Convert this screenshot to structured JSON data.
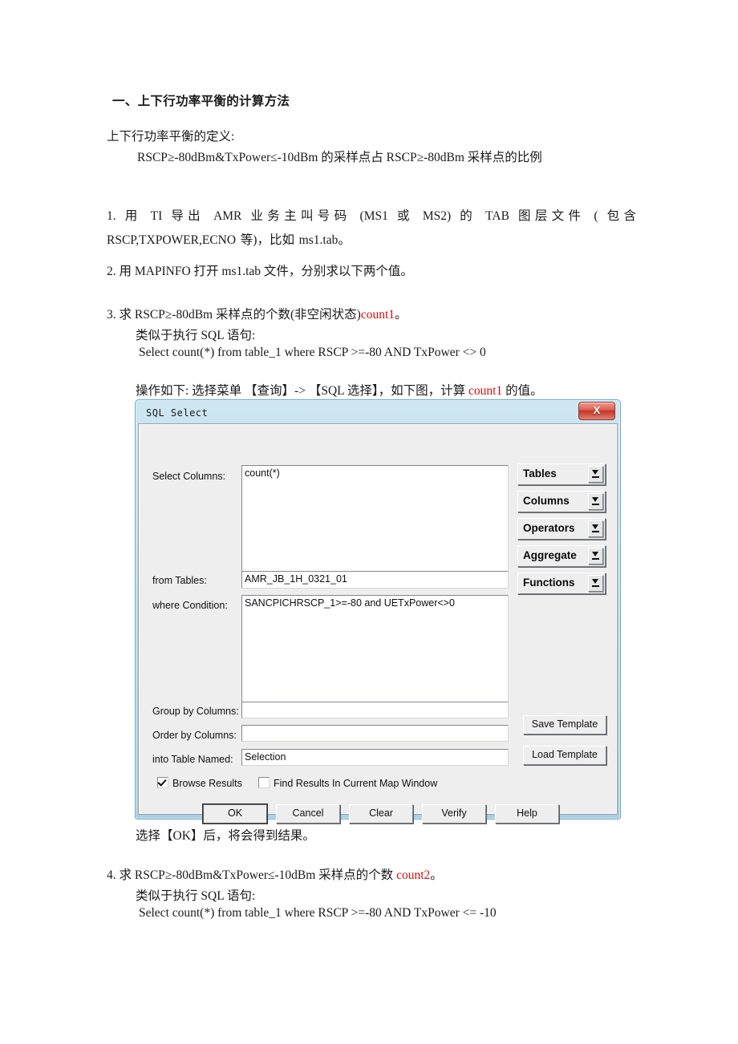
{
  "document": {
    "heading": "一、上下行功率平衡的计算方法",
    "definition_label": "上下行功率平衡的定义:",
    "definition_text": "RSCP≥-80dBm&TxPower≤-10dBm 的采样点占 RSCP≥-80dBm 采样点的比例",
    "step1": "1. 用 TI 导出 AMR 业务主叫号码 (MS1 或 MS2) 的 TAB 图层文件 ( 包含 RSCP,TXPOWER,ECNO 等)，比如 ms1.tab。",
    "step2": "2. 用 MAPINFO 打开 ms1.tab 文件，分别求以下两个值。",
    "step3_line1_a": "3. 求 RSCP≥-80dBm 采样点的个数(非空闲状态)",
    "step3_line1_red": "count1",
    "step3_line1_b": "。",
    "step3_line2": "类似于执行 SQL 语句:",
    "step3_sql": "Select count(*) from table_1 where RSCP >=-80 AND TxPower <> 0",
    "operation_a": "操作如下: 选择菜单 【查询】-> 【SQL 选择】，如下图，计算 ",
    "operation_red": "count1",
    "operation_b": " 的值。",
    "after_dialog": "选择【OK】后，将会得到结果。",
    "step4_a": "4. 求 RSCP≥-80dBm&TxPower≤-10dBm 采样点的个数 ",
    "step4_red": "count2",
    "step4_b": "。",
    "step4_line2": "类似于执行 SQL 语句:",
    "step4_sql": "Select count(*) from table_1 where RSCP >=-80 AND TxPower <= -10",
    "highlight_color": "#d01010"
  },
  "dialog": {
    "title": "SQL Select",
    "close_glyph": "X",
    "fields": {
      "select_columns_label": "Select Columns:",
      "select_columns_value": "count(*)",
      "from_tables_label": "from Tables:",
      "from_tables_value": "AMR_JB_1H_0321_01",
      "where_condition_label": "where Condition:",
      "where_condition_value": "SANCPICHRSCP_1>=-80 and UETxPower<>0",
      "group_by_label": "Group by Columns:",
      "group_by_value": "",
      "order_by_label": "Order by Columns:",
      "order_by_value": "",
      "into_table_label": "into Table Named:",
      "into_table_value": "Selection"
    },
    "dropdowns": [
      {
        "label": "Tables"
      },
      {
        "label": "Columns"
      },
      {
        "label": "Operators"
      },
      {
        "label": "Aggregate"
      },
      {
        "label": "Functions"
      }
    ],
    "template_buttons": [
      {
        "label": "Save Template"
      },
      {
        "label": "Load Template"
      }
    ],
    "checkboxes": [
      {
        "label": "Browse Results",
        "checked": true
      },
      {
        "label": "Find Results In Current Map Window",
        "checked": false
      }
    ],
    "buttons": [
      {
        "label": "OK",
        "default": true
      },
      {
        "label": "Cancel",
        "default": false
      },
      {
        "label": "Clear",
        "default": false
      },
      {
        "label": "Verify",
        "default": false
      },
      {
        "label": "Help",
        "default": false
      }
    ]
  }
}
